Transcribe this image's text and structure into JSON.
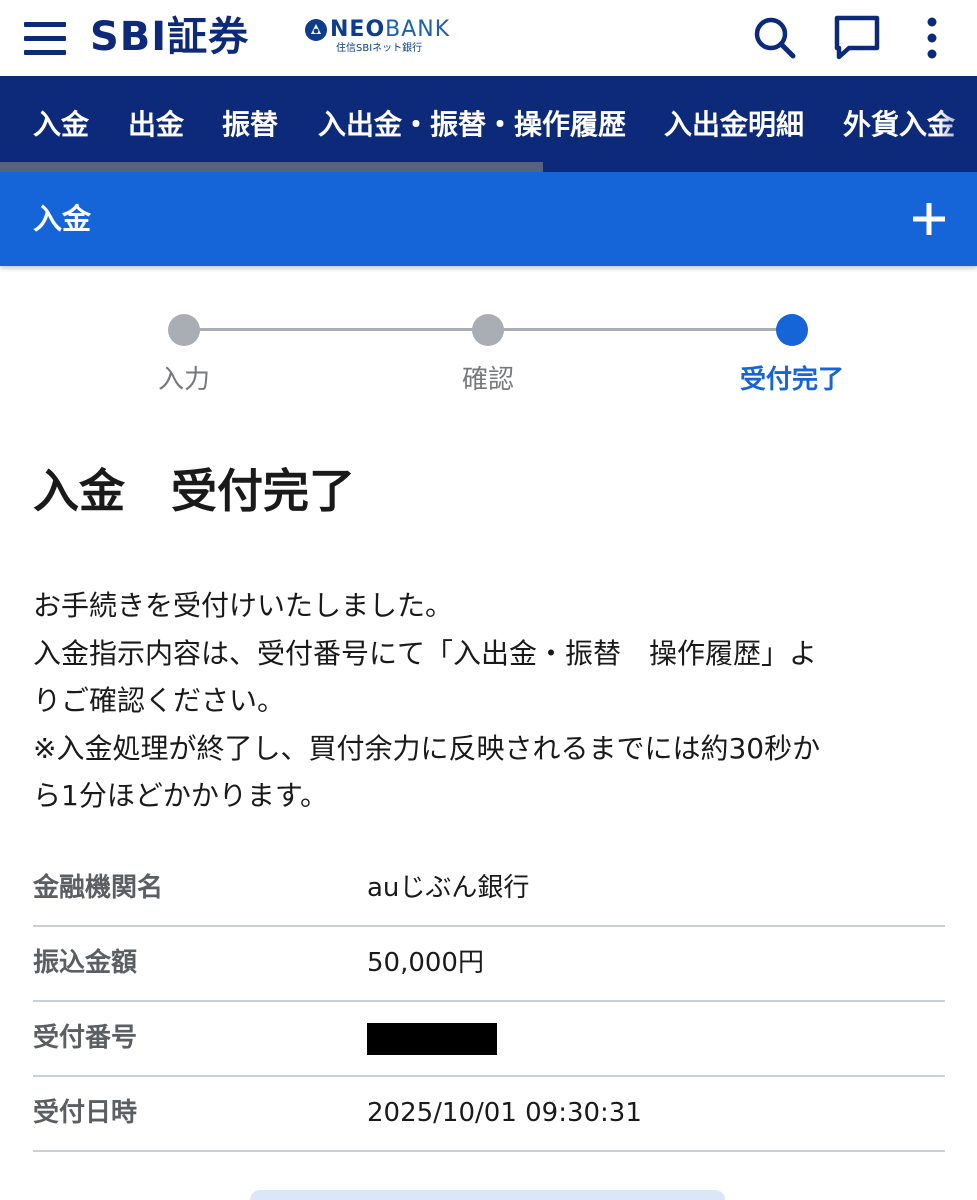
{
  "header": {
    "brand": "SBI証券",
    "partner_brand_bold": "NEO",
    "partner_brand_light": "BANK",
    "partner_sub": "住信SBIネット銀行",
    "icons": [
      "menu-icon",
      "search-icon",
      "chat-icon",
      "more-vertical-icon"
    ]
  },
  "tabs": [
    {
      "label": "入金"
    },
    {
      "label": "出金"
    },
    {
      "label": "振替"
    },
    {
      "label": "入出金・振替・操作履歴"
    },
    {
      "label": "入出金明細"
    },
    {
      "label": "外貨入金"
    }
  ],
  "accordion": {
    "title": "入金",
    "icon": "plus-icon"
  },
  "stepper": {
    "steps": [
      {
        "label": "入力",
        "state": "done"
      },
      {
        "label": "確認",
        "state": "done"
      },
      {
        "label": "受付完了",
        "state": "active"
      }
    ]
  },
  "page_title": "入金　受付完了",
  "message": {
    "line1": "お手続きを受付けいたしました。",
    "line2": "入金指示内容は、受付番号にて「入出金・振替　操作履歴」よ",
    "line3": "りご確認ください。",
    "line4": "※入金処理が終了し、買付余力に反映されるまでには約30秒か",
    "line5": "ら1分ほどかかります。"
  },
  "details": [
    {
      "label": "金融機関名",
      "value": "auじぶん銀行"
    },
    {
      "label": "振込金額",
      "value": "50,000円"
    },
    {
      "label": "受付番号",
      "value": ""
    },
    {
      "label": "受付日時",
      "value": "2025/10/01 09:30:31"
    }
  ],
  "colors": {
    "navy": "#0d2a7a",
    "accent_blue": "#1565d8",
    "step_inactive": "#a9aeb4"
  }
}
